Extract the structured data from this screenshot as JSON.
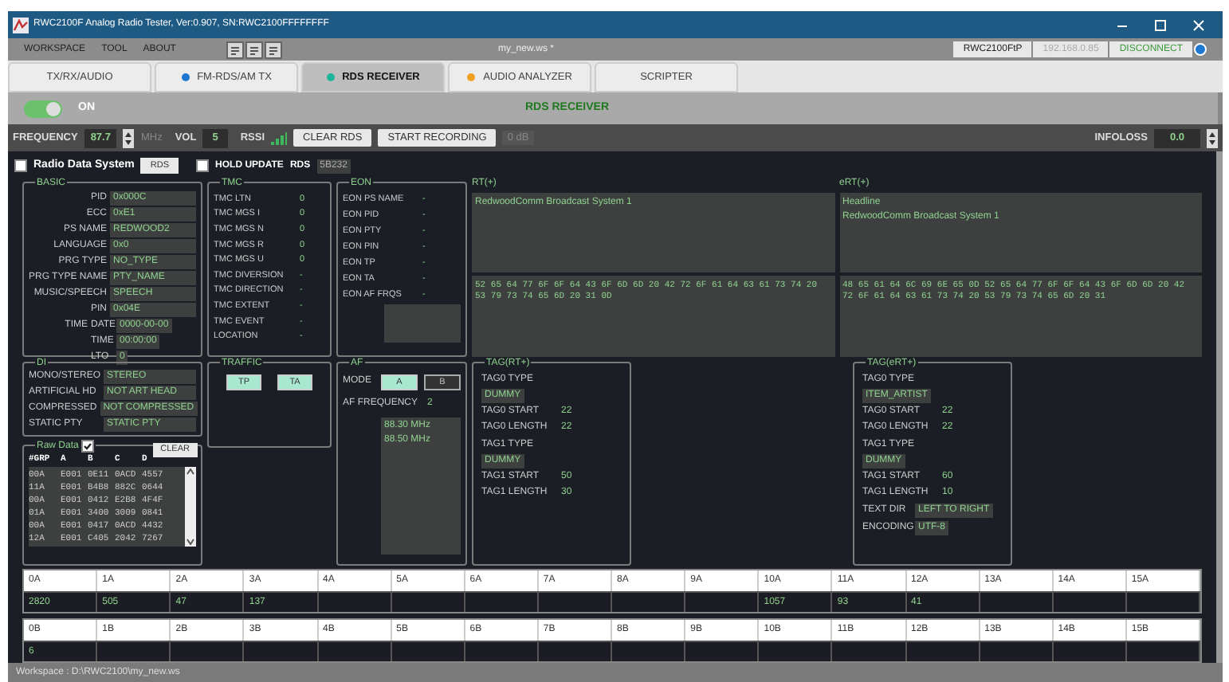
{
  "window": {
    "title": "RWC2100F Analog Radio Tester, Ver:0.907, SN:RWC2100FFFFFFFF"
  },
  "menu": {
    "items": [
      "WORKSPACE",
      "TOOL",
      "ABOUT"
    ],
    "file": "my_new.ws *",
    "device": "RWC2100FtP",
    "ip": "192.168.0.85",
    "connect_button": "DISCONNECT"
  },
  "tabs": [
    {
      "label": "TX/RX/AUDIO",
      "selected": false
    },
    {
      "label": "FM-RDS/AM TX",
      "color": "#1e78d0",
      "selected": false
    },
    {
      "label": "RDS RECEIVER",
      "color": "#1fb59a",
      "selected": true
    },
    {
      "label": "AUDIO ANALYZER",
      "color": "#f0a020",
      "selected": false
    },
    {
      "label": "SCRIPTER",
      "selected": false
    }
  ],
  "power": {
    "on": true,
    "label": "ON",
    "mode_title": "RDS RECEIVER"
  },
  "controls": {
    "frequency_label": "FREQUENCY",
    "frequency": "87.7",
    "unit": "MHz",
    "vol_label": "VOL",
    "vol": "5",
    "rssi_label": "RSSI",
    "buttons": [
      "CLEAR RDS",
      "START RECORDING"
    ],
    "recording_reading": "0 dB",
    "infoloss_label": "INFOLOSS",
    "infoloss": "0.0"
  },
  "rds_bar": {
    "rds_checkbox": {
      "label": "Radio Data System",
      "checked": false
    },
    "rds_button": "RDS",
    "hold": {
      "label": "HOLD UPDATE",
      "checked": false
    },
    "rds_label": "RDS",
    "rds_count": "5B232"
  },
  "basic": {
    "title": "BASIC",
    "fields": [
      {
        "label": "PID",
        "value": "0x000C"
      },
      {
        "label": "ECC",
        "value": "0xE1"
      },
      {
        "label": "PS NAME",
        "value": "REDWOOD2"
      },
      {
        "label": "LANGUAGE",
        "value": "0x0"
      },
      {
        "label": "PRG TYPE",
        "value": "NO_TYPE"
      },
      {
        "label": "PRG TYPE NAME",
        "value": "PTY_NAME"
      },
      {
        "label": "MUSIC/SPEECH",
        "value": "SPEECH"
      },
      {
        "label": "PIN",
        "value": "0x04E"
      }
    ],
    "time_label": "TIME",
    "time": [
      {
        "label": "DATE",
        "value": "0000-00-00"
      },
      {
        "label": "TIME",
        "value": "00:00:00"
      },
      {
        "label": "LTO",
        "value": "0"
      }
    ]
  },
  "tmc": {
    "title": "TMC",
    "fields": [
      {
        "label": "TMC LTN",
        "value": "0"
      },
      {
        "label": "TMC MGS I",
        "value": "0"
      },
      {
        "label": "TMC MGS N",
        "value": "0"
      },
      {
        "label": "TMC MGS R",
        "value": "0"
      },
      {
        "label": "TMC MGS U",
        "value": "0"
      },
      {
        "label": "TMC DIVERSION",
        "value": "-"
      },
      {
        "label": "TMC DIRECTION",
        "value": "-"
      },
      {
        "label": "TMC EXTENT",
        "value": "-"
      },
      {
        "label": "TMC EVENT",
        "value": "-"
      },
      {
        "label": "LOCATION",
        "value": "-"
      }
    ]
  },
  "eon": {
    "title": "EON",
    "fields": [
      {
        "label": "EON PS NAME",
        "value": "-"
      },
      {
        "label": "EON PID",
        "value": "-"
      },
      {
        "label": "EON PTY",
        "value": "-"
      },
      {
        "label": "EON PIN",
        "value": "-"
      },
      {
        "label": "EON TP",
        "value": "-"
      },
      {
        "label": "EON TA",
        "value": "-"
      },
      {
        "label": "EON AF FRQS",
        "value": "-"
      }
    ]
  },
  "rt": {
    "title": "RT(+)",
    "text": [
      "RedwoodComm Broadcast System 1"
    ],
    "hex": "52 65 64 77 6F 6F 64 43 6F 6D 6D 20 42 72 6F 61 64 63 61 73 74 20 53 79 73 74 65 6D 20 31 0D"
  },
  "ert": {
    "title": "eRT(+)",
    "text": [
      "Headline",
      "RedwoodComm Broadcast System 1"
    ],
    "hex": "48 65 61 64 6C 69 6E 65 0D 52 65 64 77 6F 6F 64 43 6F 6D 6D 20 42 72 6F 61 64 63 61 73 74 20 53 79 73 74 65 6D 20 31"
  },
  "di": {
    "title": "DI",
    "fields": [
      {
        "label": "MONO/STEREO",
        "value": "STEREO"
      },
      {
        "label": "ARTIFICIAL HD",
        "value": "NOT ART HEAD"
      },
      {
        "label": "COMPRESSED",
        "value": "NOT COMPRESSED"
      },
      {
        "label": "STATIC PTY",
        "value": "STATIC PTY"
      }
    ]
  },
  "raw": {
    "title": "Raw Data",
    "checked": true,
    "clear_button": "CLEAR",
    "columns": [
      "#GRP",
      "A",
      "B",
      "C",
      "D"
    ],
    "rows": [
      [
        "00A",
        "E001",
        "0E11",
        "0ACD",
        "4557"
      ],
      [
        "11A",
        "E001",
        "B4B8",
        "882C",
        "0644"
      ],
      [
        "00A",
        "E001",
        "0412",
        "E2B8",
        "4F4F"
      ],
      [
        "01A",
        "E001",
        "3400",
        "3009",
        "0841"
      ],
      [
        "00A",
        "E001",
        "0417",
        "0ACD",
        "4432"
      ],
      [
        "12A",
        "E001",
        "C405",
        "2042",
        "7267"
      ]
    ]
  },
  "traffic": {
    "title": "TRAFFIC",
    "flags": [
      {
        "label": "TP",
        "on": true
      },
      {
        "label": "TA",
        "on": true
      }
    ]
  },
  "af": {
    "title": "AF",
    "mode_label": "MODE",
    "modes": [
      {
        "label": "A",
        "selected": true
      },
      {
        "label": "B",
        "selected": false
      }
    ],
    "frequency_label": "AF FREQUENCY",
    "frequency_count": "2",
    "frequencies": [
      "88.30 MHz",
      "88.50 MHz"
    ]
  },
  "tag_rt": {
    "title": "TAG(RT+)",
    "items": [
      {
        "kind": "type",
        "label": "TAG0 TYPE",
        "value": "DUMMY"
      },
      {
        "kind": "number",
        "label": "TAG0 START",
        "value": "22"
      },
      {
        "kind": "number",
        "label": "TAG0 LENGTH",
        "value": "22"
      },
      {
        "kind": "type",
        "label": "TAG1 TYPE",
        "value": "DUMMY"
      },
      {
        "kind": "number",
        "label": "TAG1 START",
        "value": "50"
      },
      {
        "kind": "number",
        "label": "TAG1 LENGTH",
        "value": "30"
      }
    ]
  },
  "tag_ert": {
    "title": "TAG(eRT+)",
    "items": [
      {
        "kind": "type",
        "label": "TAG0 TYPE",
        "value": "ITEM_ARTIST"
      },
      {
        "kind": "number",
        "label": "TAG0 START",
        "value": "22"
      },
      {
        "kind": "number",
        "label": "TAG0 LENGTH",
        "value": "22"
      },
      {
        "kind": "type",
        "label": "TAG1 TYPE",
        "value": "DUMMY"
      },
      {
        "kind": "number",
        "label": "TAG1 START",
        "value": "60"
      },
      {
        "kind": "number",
        "label": "TAG1 LENGTH",
        "value": "10"
      },
      {
        "kind": "boxed",
        "label": "TEXT DIR",
        "value": "LEFT TO RIGHT"
      },
      {
        "kind": "boxed",
        "label": "ENCODING",
        "value": "UTF-8"
      }
    ]
  },
  "group_counts_a": [
    {
      "header": "0A",
      "value": "2820"
    },
    {
      "header": "1A",
      "value": "505"
    },
    {
      "header": "2A",
      "value": "47"
    },
    {
      "header": "3A",
      "value": "137"
    },
    {
      "header": "4A"
    },
    {
      "header": "5A"
    },
    {
      "header": "6A"
    },
    {
      "header": "7A"
    },
    {
      "header": "8A"
    },
    {
      "header": "9A"
    },
    {
      "header": "10A",
      "value": "1057"
    },
    {
      "header": "11A",
      "value": "93"
    },
    {
      "header": "12A",
      "value": "41"
    },
    {
      "header": "13A"
    },
    {
      "header": "14A"
    },
    {
      "header": "15A"
    }
  ],
  "group_counts_b": [
    {
      "header": "0B",
      "value": "6"
    },
    {
      "header": "1B"
    },
    {
      "header": "2B"
    },
    {
      "header": "3B"
    },
    {
      "header": "4B"
    },
    {
      "header": "5B"
    },
    {
      "header": "6B"
    },
    {
      "header": "7B"
    },
    {
      "header": "8B"
    },
    {
      "header": "9B"
    },
    {
      "header": "10B"
    },
    {
      "header": "11B"
    },
    {
      "header": "12B"
    },
    {
      "header": "13B"
    },
    {
      "header": "14B"
    },
    {
      "header": "15B"
    }
  ],
  "status_bar": {
    "text": "Workspace : D:\\RWC2100\\my_new.ws"
  }
}
